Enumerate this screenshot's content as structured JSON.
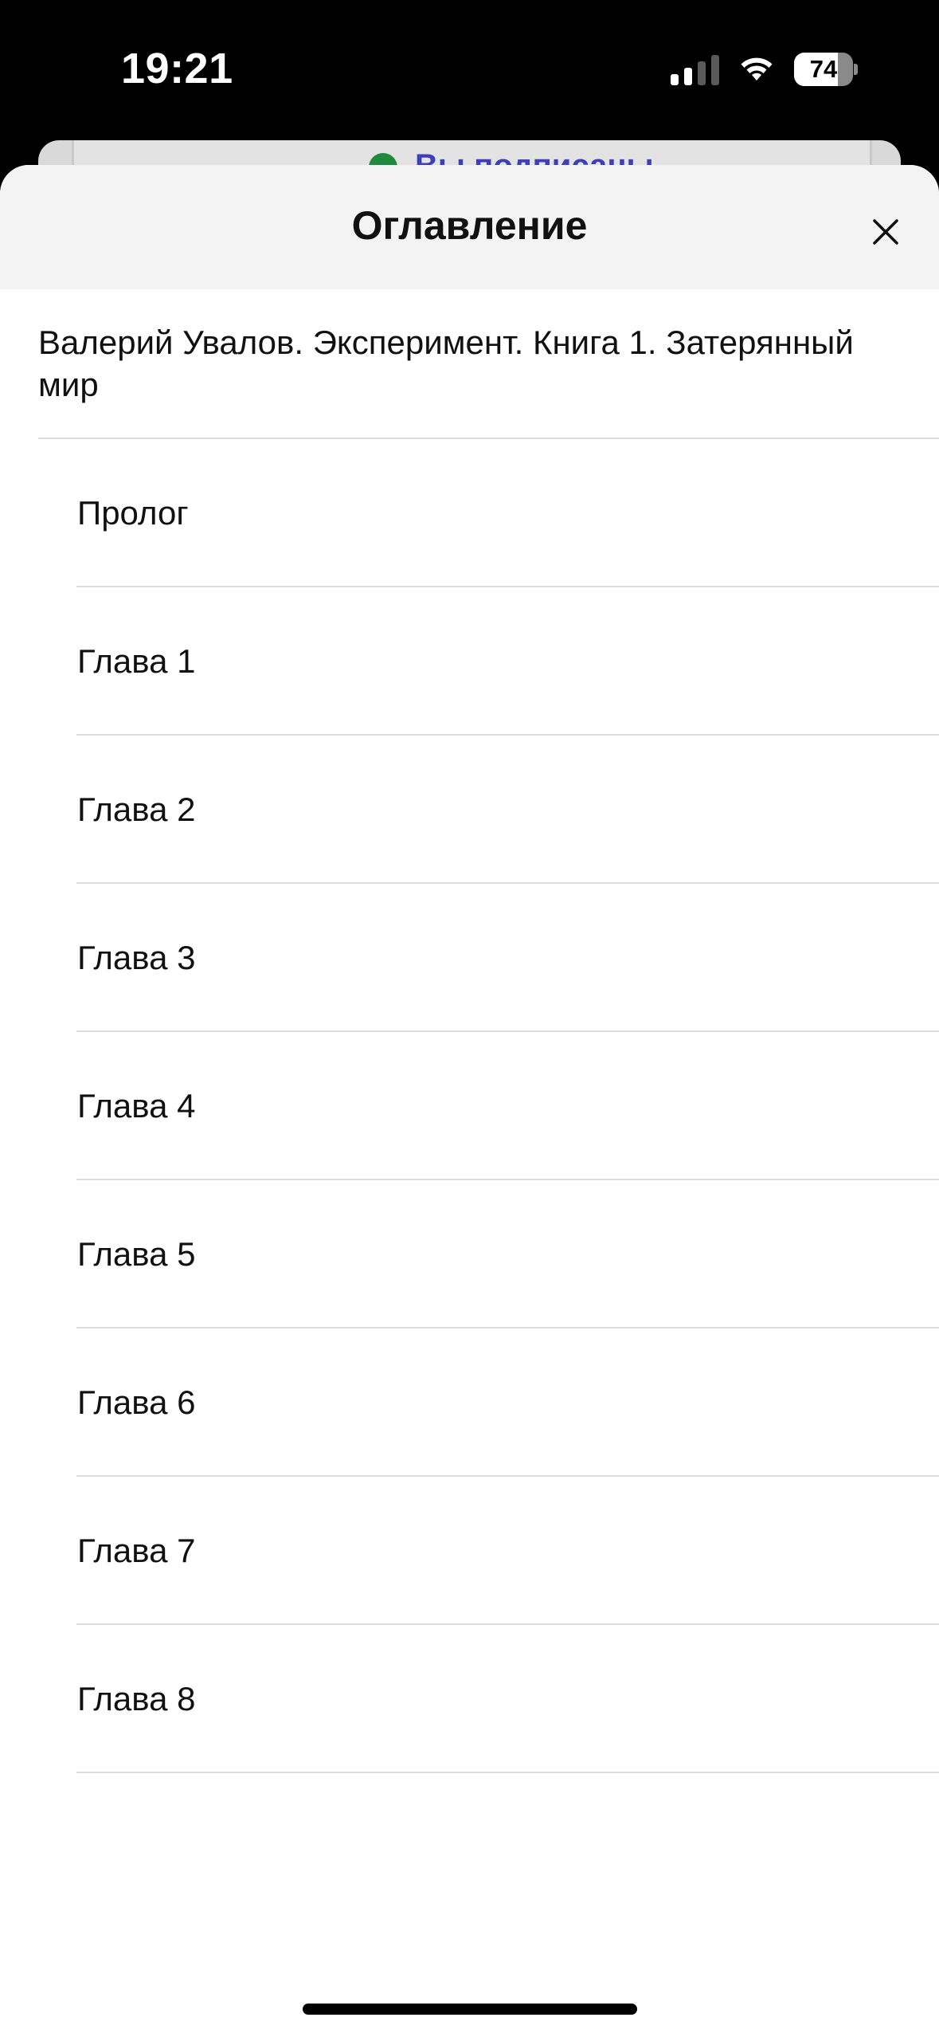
{
  "status_bar": {
    "time": "19:21",
    "battery_level": "74",
    "signal_bars_active": 2,
    "signal_bars_total": 4,
    "icons": [
      "signal-icon",
      "wifi-icon",
      "battery-icon"
    ]
  },
  "background_screen": {
    "banner_text": "Вы подписаны"
  },
  "sheet": {
    "title": "Оглавление",
    "close_icon": "close-icon",
    "book_title": "Валерий Увалов. Эксперимент. Книга 1. Затерянный мир",
    "items": [
      {
        "label": "Пролог"
      },
      {
        "label": "Глава 1"
      },
      {
        "label": "Глава 2"
      },
      {
        "label": "Глава 3"
      },
      {
        "label": "Глава 4"
      },
      {
        "label": "Глава 5"
      },
      {
        "label": "Глава 6"
      },
      {
        "label": "Глава 7"
      },
      {
        "label": "Глава 8"
      }
    ]
  },
  "colors": {
    "header_background": "#f3f3f3",
    "divider": "#dcdcdc",
    "text": "#111111",
    "subscribed_text": "#3d3fb8",
    "subscribed_check": "#1f8a3b"
  }
}
